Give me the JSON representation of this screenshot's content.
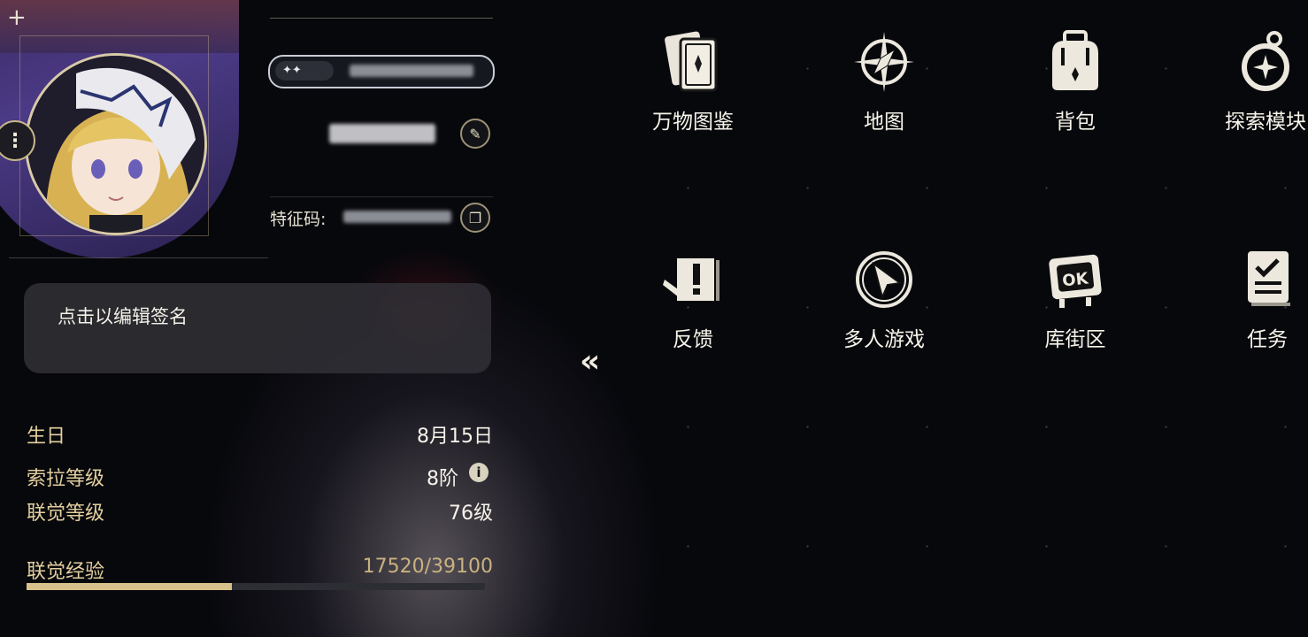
{
  "profile": {
    "feature_code_label": "特征码:",
    "signature_placeholder": "点击以编辑签名"
  },
  "stats": {
    "birthday_label": "生日",
    "birthday_value": "8月15日",
    "sora_level_label": "索拉等级",
    "sora_level_value": "8阶",
    "union_level_label": "联觉等级",
    "union_level_value": "76级",
    "union_exp_label": "联觉经验",
    "union_exp_value": "17520/39100",
    "union_exp_fraction": 0.448
  },
  "menu": {
    "items": [
      {
        "label": "万物图鉴",
        "icon": "card-deck-icon"
      },
      {
        "label": "地图",
        "icon": "compass-icon"
      },
      {
        "label": "背包",
        "icon": "backpack-icon"
      },
      {
        "label": "探索模块",
        "icon": "explore-orb-icon"
      },
      {
        "label": "反馈",
        "icon": "feedback-icon"
      },
      {
        "label": "多人游戏",
        "icon": "multiplayer-cursor-icon"
      },
      {
        "label": "库街区",
        "icon": "kuro-community-icon"
      },
      {
        "label": "任务",
        "icon": "task-clipboard-icon"
      }
    ]
  },
  "colors": {
    "accent_gold": "#d8c08a",
    "label_gold": "#e3cf9f",
    "background": "#07080c"
  }
}
